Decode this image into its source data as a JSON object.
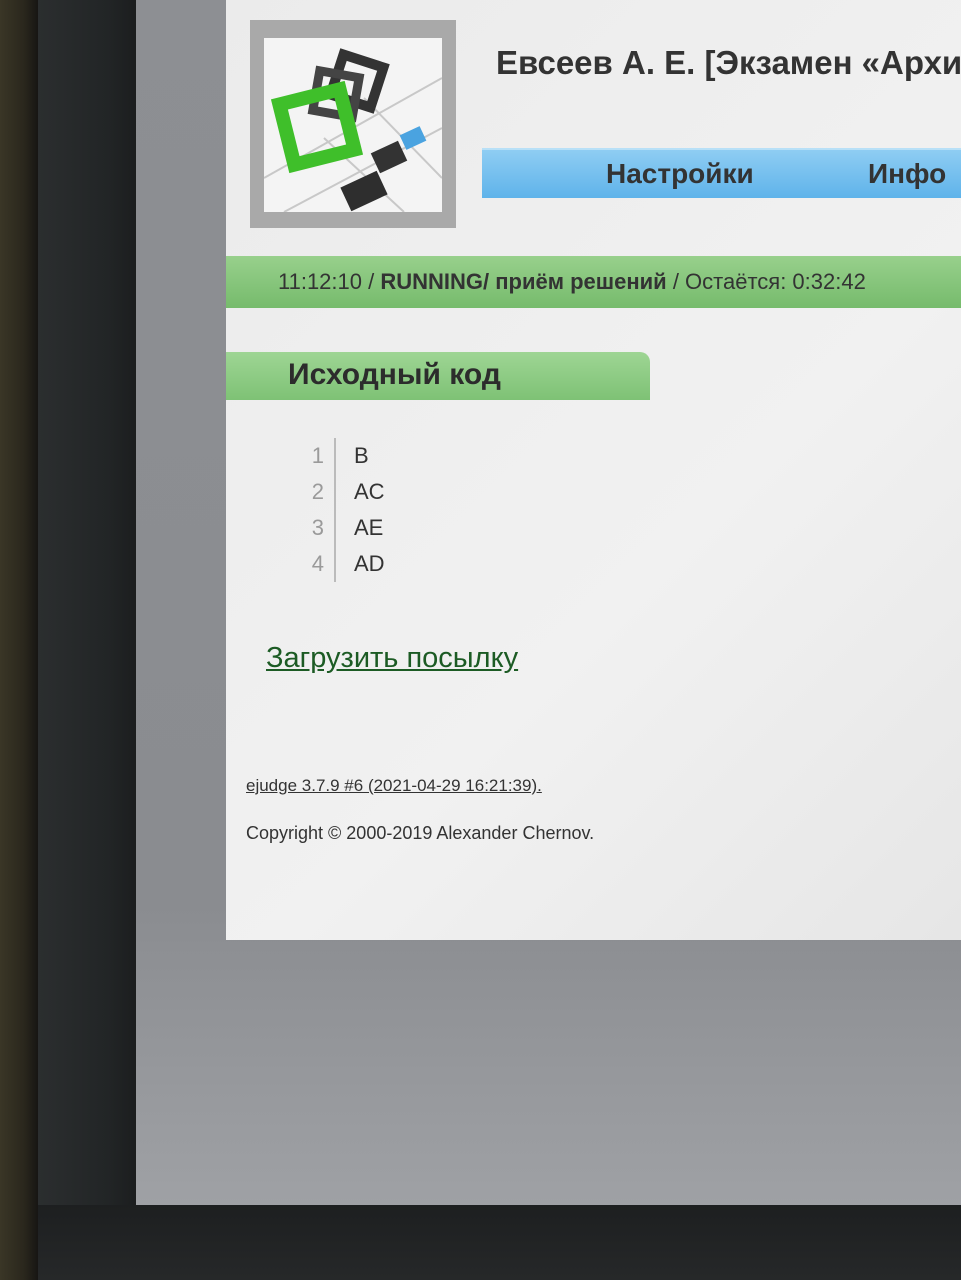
{
  "header": {
    "title": "Евсеев А. Е. [Экзамен «Архи",
    "menu": [
      {
        "label": "Настройки"
      },
      {
        "label": "Инфо"
      }
    ]
  },
  "status": {
    "time": "11:12:10",
    "separator1": " / ",
    "state": "RUNNING/ приём решений",
    "separator2": " / ",
    "remaining": "Остаётся: 0:32:42"
  },
  "section": {
    "title": "Исходный код"
  },
  "code": {
    "lines": [
      {
        "num": "1",
        "text": "B"
      },
      {
        "num": "2",
        "text": "AC"
      },
      {
        "num": "3",
        "text": "AE"
      },
      {
        "num": "4",
        "text": "AD"
      }
    ]
  },
  "links": {
    "upload": "Загрузить посылку",
    "version": "ejudge 3.7.9 #6 (2021-04-29 16:21:39)."
  },
  "footer": {
    "copyright": "Copyright © 2000-2019 Alexander Chernov."
  },
  "colors": {
    "menu_blue": "#5fb3ea",
    "status_green": "#76bb6c",
    "logo_green": "#3fbf2a"
  },
  "icons": {
    "logo": "ejudge-logo-icon"
  }
}
